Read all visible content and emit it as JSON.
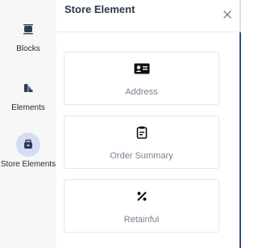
{
  "rail": {
    "items": [
      {
        "label": "Blocks",
        "icon": "blocks-icon"
      },
      {
        "label": "Elements",
        "icon": "elements-icon"
      },
      {
        "label": "Store Elements",
        "icon": "store-elements-icon",
        "active": true
      }
    ]
  },
  "panel": {
    "title": "Store Element",
    "close_icon": "close-icon",
    "cards": [
      {
        "label": "Address",
        "icon": "address-card-icon"
      },
      {
        "label": "Order Summary",
        "icon": "order-summary-icon"
      },
      {
        "label": "Retainful",
        "icon": "percent-icon"
      }
    ]
  },
  "colors": {
    "rail_background": "#f7f7f8",
    "active_icon_background": "#d6dcf5",
    "title": "#2b3a4e",
    "card_label": "#7a8191",
    "accent_edge": "#2d4f8a"
  }
}
